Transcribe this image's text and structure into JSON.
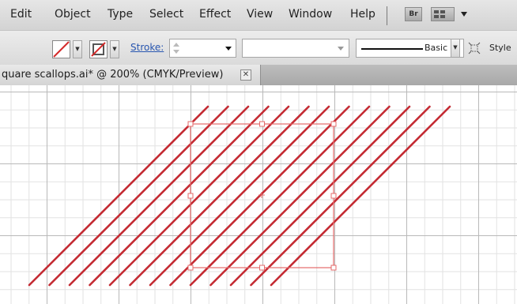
{
  "menu": [
    "Edit",
    "Object",
    "Type",
    "Select",
    "Effect",
    "View",
    "Window",
    "Help"
  ],
  "menu_icons": {
    "bridge": "Br",
    "arrange": "arrange-documents-icon"
  },
  "control_bar": {
    "stroke_label": "Stroke:",
    "brush_value": "",
    "profile_label": "Basic",
    "style_label": "Style"
  },
  "document": {
    "tab_title": "quare scallops.ai* @ 200% (CMYK/Preview)",
    "close_symbol": "✕"
  },
  "colors": {
    "artwork_stroke": "#c42b33",
    "selection": "#e46a6a",
    "grid_major": "#b9b9b9",
    "grid_minor": "#e2e2e2"
  },
  "artwork": {
    "diagonal_line_count": 13
  }
}
